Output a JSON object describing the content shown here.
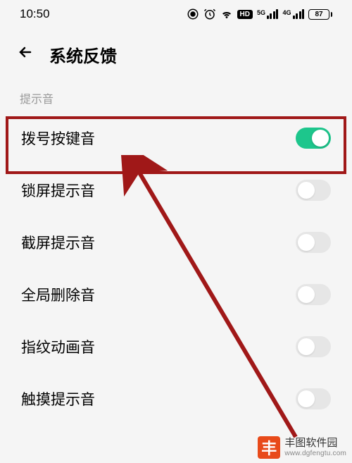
{
  "status": {
    "time": "10:50",
    "hd_label": "HD",
    "sig1_label": "5G",
    "sig2_label": "4G",
    "battery_pct": "87"
  },
  "header": {
    "title": "系统反馈"
  },
  "section": {
    "label": "提示音"
  },
  "settings": [
    {
      "label": "拨号按键音",
      "on": true
    },
    {
      "label": "锁屏提示音",
      "on": false
    },
    {
      "label": "截屏提示音",
      "on": false
    },
    {
      "label": "全局删除音",
      "on": false
    },
    {
      "label": "指纹动画音",
      "on": false
    },
    {
      "label": "触摸提示音",
      "on": false
    }
  ],
  "watermark": {
    "logo_char": "丰",
    "title": "丰图软件园",
    "url": "www.dgfengtu.com"
  },
  "colors": {
    "toggle_on": "#1dc68c",
    "highlight": "#a01818",
    "brand": "#e84a1a"
  }
}
